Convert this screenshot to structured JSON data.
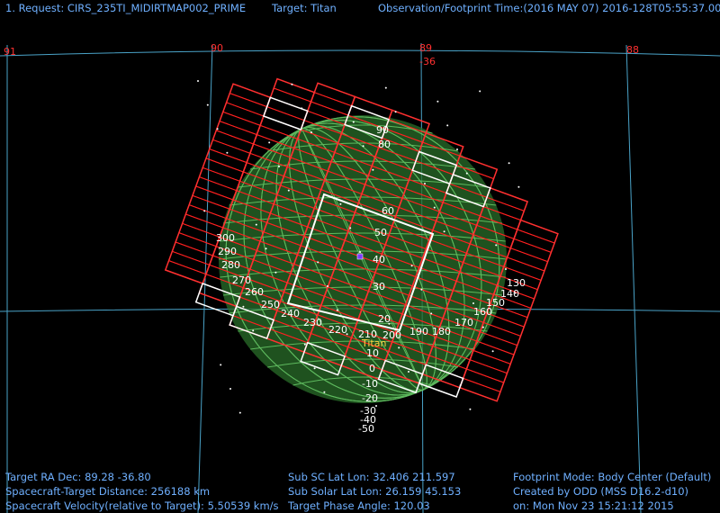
{
  "header": {
    "request": "1. Request: CIRS_235TI_MIDIRTMAP002_PRIME",
    "target": "Target: Titan",
    "time": "Observation/Footprint Time:(2016 MAY 07) 2016-128T05:55:37.00"
  },
  "grid_labels": {
    "ra": [
      "91",
      "90",
      "89",
      "88"
    ],
    "dec": "-36"
  },
  "globe": {
    "target_label": "Titan",
    "lat_labels": [
      "90",
      "80",
      "60",
      "50",
      "40",
      "30",
      "20",
      "10",
      "0",
      "-10",
      "-20",
      "-30",
      "-40",
      "-50"
    ],
    "lon_labels": [
      "300",
      "290",
      "280",
      "270",
      "260",
      "250",
      "240",
      "230",
      "220",
      "210",
      "200",
      "190",
      "180",
      "170",
      "160",
      "150",
      "140",
      "130"
    ]
  },
  "footer": {
    "left": [
      "Target RA Dec: 89.28  -36.80",
      "Spacecraft-Target Distance:  256188 km",
      "Spacecraft Velocity(relative to Target): 5.50539 km/s"
    ],
    "middle": [
      "Sub SC Lat Lon: 32.406  211.597",
      "Sub Solar Lat Lon: 26.159  45.153",
      "Target Phase Angle: 120.03"
    ],
    "right": [
      "Footprint Mode: Body Center (Default)",
      "Created by ODD (MSS D16.2-d10)",
      "on: Mon Nov 23 15:21:12 2015"
    ]
  },
  "colors": {
    "background": "#000000",
    "text": "#6fb0ff",
    "grid": "#4aa3c8",
    "footprint": "#ff2020",
    "footprint_white": "#ffffff",
    "globe": "#3c8c3c",
    "globe_lines": "#6ed46e",
    "target_marker": "#7a3cff"
  }
}
